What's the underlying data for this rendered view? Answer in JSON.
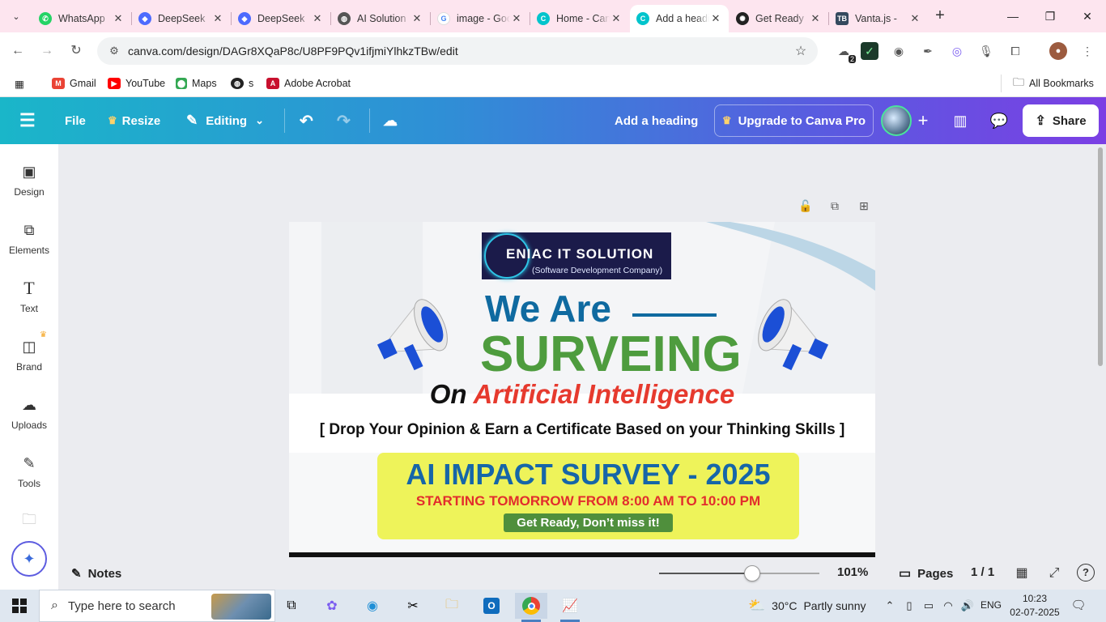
{
  "browser": {
    "tabs": [
      {
        "title": "WhatsApp",
        "favicon": "whatsapp-icon",
        "color": "#25d366",
        "active": false
      },
      {
        "title": "DeepSeek",
        "favicon": "deepseek-icon",
        "color": "#4d6bfe",
        "active": false
      },
      {
        "title": "DeepSeek",
        "favicon": "deepseek-icon",
        "color": "#4d6bfe",
        "active": false
      },
      {
        "title": "AI Solution",
        "favicon": "globe-icon",
        "color": "#555555",
        "active": false
      },
      {
        "title": "image - Google",
        "favicon": "google-icon",
        "color": "#4285f4",
        "active": false
      },
      {
        "title": "Home - Canva",
        "favicon": "canva-icon",
        "color": "#00c4cc",
        "active": false
      },
      {
        "title": "Add a heading",
        "favicon": "canva-icon",
        "color": "#00c4cc",
        "active": true
      },
      {
        "title": "Get Ready",
        "favicon": "openai-icon",
        "color": "#222222",
        "active": false
      },
      {
        "title": "Vanta.js - ",
        "favicon": "tb-icon",
        "color": "#34495e",
        "active": false
      }
    ],
    "tab_close": "✕",
    "new_tab": "+",
    "url": "canva.com/design/DAGr8XQaP8c/U8PF9PQv1ifjmiYlhkzTBw/edit",
    "extension_badge": "2",
    "bookmarks": [
      {
        "label": "Gmail",
        "icon": "gmail-icon",
        "color": "#ea4335"
      },
      {
        "label": "YouTube",
        "icon": "youtube-icon",
        "color": "#ff0000"
      },
      {
        "label": "Maps",
        "icon": "maps-icon",
        "color": "#34a853"
      },
      {
        "label": "s",
        "icon": "globe-icon",
        "color": "#222222"
      },
      {
        "label": "Adobe Acrobat",
        "icon": "acrobat-icon",
        "color": "#c8102e"
      }
    ],
    "all_bookmarks": "All Bookmarks"
  },
  "canva": {
    "header": {
      "file": "File",
      "resize": "Resize",
      "editing": "Editing",
      "doc_title": "Add a heading",
      "upgrade": "Upgrade to Canva Pro",
      "share": "Share"
    },
    "rail": [
      {
        "label": "Design",
        "icon": "design-icon",
        "glyph": "▣"
      },
      {
        "label": "Elements",
        "icon": "elements-icon",
        "glyph": "⧉"
      },
      {
        "label": "Text",
        "icon": "text-icon",
        "glyph": "T"
      },
      {
        "label": "Brand",
        "icon": "brand-icon",
        "glyph": "◫"
      },
      {
        "label": "Uploads",
        "icon": "uploads-icon",
        "glyph": "☁"
      },
      {
        "label": "Tools",
        "icon": "tools-icon",
        "glyph": "✎"
      }
    ],
    "design": {
      "logo_name": "ENIAC IT SOLUTION",
      "logo_sub": "(Software Development Company)",
      "we_are": "We Are",
      "surveing": "SURVEING",
      "on": "On",
      "ai": "Artificial Intelligence",
      "opinion": "[ Drop Your Opinion & Earn a Certificate Based on your Thinking Skills ]",
      "survey_title": "AI IMPACT SURVEY - 2025",
      "survey_time": "STARTING TOMORROW FROM 8:00 AM TO 10:00 PM",
      "get_ready": "Get Ready, Don’t miss it!"
    },
    "footer": {
      "notes": "Notes",
      "zoom_percent": "101%",
      "zoom_level": 0.58,
      "pages": "Pages",
      "page_count": "1 / 1"
    }
  },
  "taskbar": {
    "search_placeholder": "Type here to search",
    "weather_temp": "30°C",
    "weather_desc": "Partly sunny",
    "lang": "ENG",
    "time": "10:23",
    "date": "02-07-2025"
  }
}
